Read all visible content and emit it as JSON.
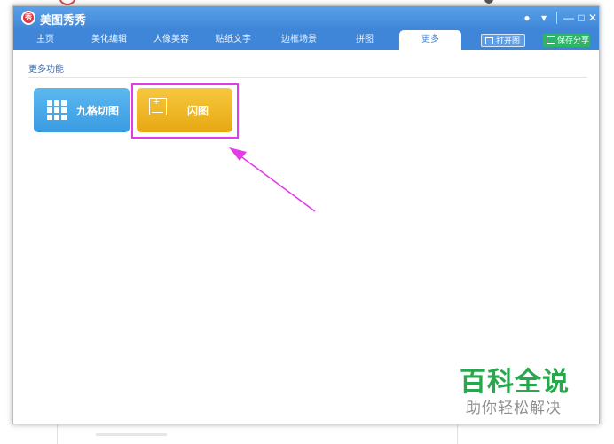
{
  "app": {
    "title": "美图秀秀",
    "logo_text": "秀"
  },
  "titlebar_icons": [
    {
      "icon": "chat-bubble-icon",
      "glyph": "●"
    },
    {
      "icon": "dropdown-menu-icon",
      "glyph": "▾"
    },
    {
      "icon": "minimize-icon",
      "glyph": "—"
    },
    {
      "icon": "maximize-icon",
      "glyph": "□"
    },
    {
      "icon": "close-icon",
      "glyph": "✕"
    }
  ],
  "tabs": [
    {
      "label": "主页"
    },
    {
      "label": "美化编辑"
    },
    {
      "label": "人像美容"
    },
    {
      "label": "贴纸文字"
    },
    {
      "label": "边框场景"
    },
    {
      "label": "拼图"
    },
    {
      "label": "更多",
      "active": true
    }
  ],
  "actions": {
    "open_label": "打开图片",
    "save_label": "保存分享"
  },
  "section": {
    "title": "更多功能"
  },
  "features": [
    {
      "label": "九格切图",
      "icon": "nine-grid-icon",
      "color": "#4aa8e8"
    },
    {
      "label": "闪图",
      "icon": "frame-plus-icon",
      "color": "#f0b82a"
    }
  ],
  "colors": {
    "titlebar": "#4a90e2",
    "highlight": "#e33be6",
    "save_button": "#2db46a",
    "watermark_green": "#27a84c"
  },
  "watermark": {
    "main": "百科全说",
    "sub": "助你轻松解决"
  }
}
